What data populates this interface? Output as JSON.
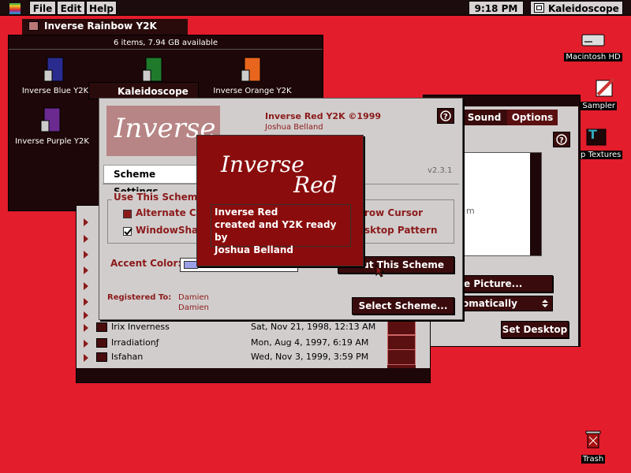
{
  "menubar": {
    "items": [
      "File",
      "Edit",
      "Help"
    ],
    "clock": "9:18 PM",
    "app_name": "Kaleidoscope"
  },
  "desktop_icons": [
    "Macintosh HD",
    "Sampler",
    "top Textures",
    "Trash"
  ],
  "folder_window": {
    "title": "Inverse Rainbow Y2K",
    "info": "6 items, 7.94 GB available",
    "items": [
      "Inverse Blue Y2K",
      "Inverse Purple Y2K",
      "Inverse Orange Y2K"
    ]
  },
  "kaleido_tab": "Kaleidoscope",
  "prefs_window": {
    "tabs": [
      "Sound",
      "Options"
    ],
    "buttons": [
      "e Picture...",
      "Set Desktop"
    ],
    "popup_value": "omatically"
  },
  "scheme_window": {
    "scheme_title": "Inverse Red Y2K ©1999",
    "author": "Joshua Belland",
    "version": "v2.3.1",
    "tab_label": "Scheme Settings",
    "group_label": "Use This Scheme'",
    "options": [
      "Alternate Ch",
      "WindowShad",
      "row Cursor",
      "sktop Pattern"
    ],
    "accent_label": "Accent Color:",
    "about_button": "out This Scheme",
    "registered_label": "Registered To:",
    "registered_names": [
      "Damien",
      "Damien"
    ],
    "select_button": "Select Scheme...",
    "logo_text": "Inverse"
  },
  "splash": {
    "logo_line1": "Inverse",
    "logo_line2": "Red",
    "text_lines": [
      "Inverse Red",
      "created and Y2K ready by",
      "Joshua Belland"
    ]
  },
  "list": {
    "rows": [
      {
        "name": "Irix Inverness",
        "date": "Sat, Nov 21, 1998, 12:13 AM"
      },
      {
        "name": "Irradiationƒ",
        "date": "Mon, Aug 4, 1997, 6:19 AM"
      },
      {
        "name": "Isfahan",
        "date": "Wed, Nov 3, 1999, 3:59 PM"
      }
    ],
    "stub_m": "m"
  },
  "colors": {
    "desktop": "#e31d2c",
    "window_dark": "#1e0708",
    "accent": "#8b1a1a",
    "panel": "#d2cdcd",
    "splash": "#8a0c0c"
  }
}
